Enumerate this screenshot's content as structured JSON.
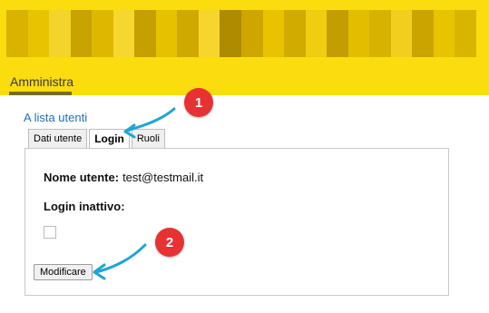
{
  "header": {
    "background": "#fbdc0f",
    "blurred_banner_colors": [
      "#d9b300",
      "#e8c400",
      "#f3d42a",
      "#c9a300",
      "#deb800",
      "#f5d730",
      "#c6a000",
      "#e6c100",
      "#d0a900",
      "#f7d52d",
      "#ad8c00",
      "#cfa600",
      "#e9c200",
      "#d2ab00",
      "#f0cd10",
      "#c49e00",
      "#e3bd00",
      "#d8b200",
      "#f2cf1e",
      "#cca400",
      "#e8c300",
      "#dab500"
    ],
    "nav_tab_label": "Amministra"
  },
  "back_link": "A lista utenti",
  "tabs": [
    {
      "label": "Dati utente",
      "active": false
    },
    {
      "label": "Login",
      "active": true
    },
    {
      "label": "Ruoli",
      "active": false
    }
  ],
  "form": {
    "username_label": "Nome utente:",
    "username_value": "test@testmail.it",
    "inactive_label": "Login inattivo:",
    "inactive_checked": false,
    "submit_label": "Modificare"
  },
  "annotations": {
    "badge_color": "#e63233",
    "arrow_color": "#1ea5d6",
    "badges": [
      "1",
      "2"
    ]
  }
}
